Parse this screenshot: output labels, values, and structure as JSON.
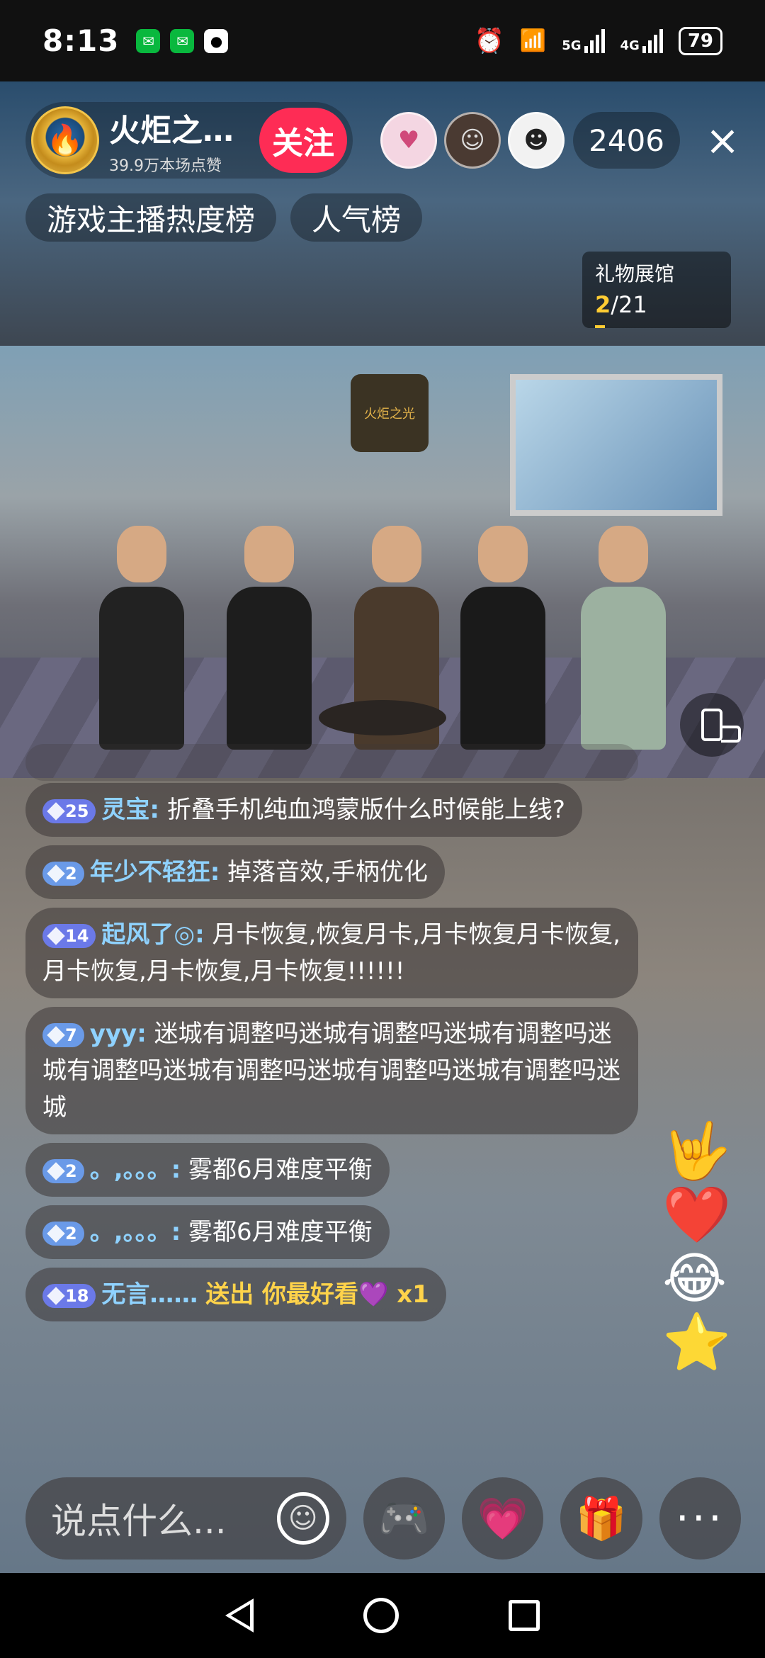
{
  "status_bar": {
    "time": "8:13",
    "battery": "79",
    "network1": "5G",
    "network2": "4G"
  },
  "header": {
    "host_name": "火炬之…",
    "host_likes": "39.9万本场点赞",
    "follow_label": "关注",
    "viewer_count": "2406",
    "close_icon": "×"
  },
  "ranks": {
    "game_rank": "游戏主播热度榜",
    "popular_rank": "人气榜"
  },
  "gift_hall": {
    "label": "礼物展馆",
    "current": "2",
    "total": "/21"
  },
  "video": {
    "stage_logo": "火炬之光"
  },
  "chat": [
    {
      "level": "25",
      "user": "灵宝:",
      "text": "折叠手机纯血鸿蒙版什么时候能上线?"
    },
    {
      "level": "2",
      "user": "年少不轻狂:",
      "text": "掉落音效,手柄优化"
    },
    {
      "level": "14",
      "user": "起风了◎:",
      "text": "月卡恢复,恢复月卡,月卡恢复月卡恢复,月卡恢复,月卡恢复,月卡恢复!!!!!!"
    },
    {
      "level": "7",
      "user": "yyy:",
      "text": "迷城有调整吗迷城有调整吗迷城有调整吗迷城有调整吗迷城有调整吗迷城有调整吗迷城有调整吗迷城"
    },
    {
      "level": "2",
      "user": "。,。。。:",
      "text": "雾都6月难度平衡"
    },
    {
      "level": "2",
      "user": "。,。。。:",
      "text": "雾都6月难度平衡"
    },
    {
      "level": "18",
      "user": "无言……",
      "text": "送出 你最好看💜 x1"
    }
  ],
  "bottom_bar": {
    "input_placeholder": "说点什么..."
  },
  "icons": {
    "emoji": "smile-icon",
    "game": "gamepad-icon",
    "heart": "heart-planet-icon",
    "gift": "gift-icon",
    "more": "more-icon"
  },
  "colors": {
    "follow": "#fe2c55",
    "username": "#8fd2ff",
    "gift_text": "#ffd34a"
  }
}
